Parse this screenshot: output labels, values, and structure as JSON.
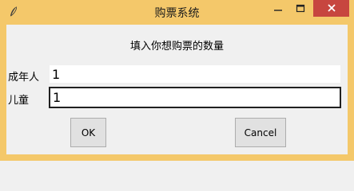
{
  "window": {
    "title": "购票系统",
    "icons": {
      "app": "feather-icon",
      "minimize": "minimize-icon",
      "maximize": "maximize-icon",
      "close": "close-icon"
    },
    "colors": {
      "titlebar": "#f4c86a",
      "close_button": "#c7463f",
      "client_background": "#f0f0f0"
    }
  },
  "form": {
    "prompt": "填入你想购票的数量",
    "adult_label": "成年人",
    "adult_value": "1",
    "child_label": "儿童",
    "child_value": "1"
  },
  "buttons": {
    "ok_label": "OK",
    "cancel_label": "Cancel"
  }
}
